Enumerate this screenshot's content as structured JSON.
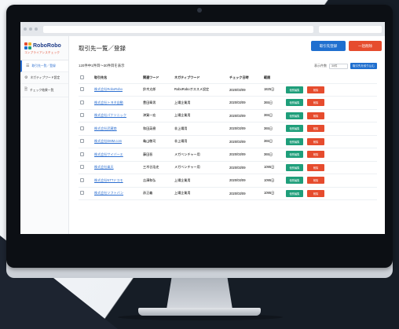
{
  "browser": {
    "url": "",
    "search_placeholder": ""
  },
  "sidebar": {
    "logo_name": "RoboRobo",
    "logo_sub": "コンプライアンスチェック",
    "items": [
      {
        "label": "取引先一覧／登録",
        "icon": "list-icon"
      },
      {
        "label": "ネガティブワード設定",
        "icon": "gear-icon"
      },
      {
        "label": "チェック結果一覧",
        "icon": "document-icon"
      }
    ]
  },
  "main": {
    "title": "取引先一覧／登録",
    "register_button": "取引先登録",
    "bulk_delete_button": "一括削除",
    "range_text": "120件中1件目〜30件目を表示",
    "per_page_label": "表示件数",
    "per_page_value": "30件",
    "per_page_button": "取引先を絞り込む",
    "columns": [
      "取引先名",
      "関連ワード",
      "ネガティブワード",
      "チェック日時",
      "範囲"
    ],
    "edit_label": "個別編集",
    "delete_label": "削除",
    "rows": [
      {
        "name": "株式会社RoboRobo",
        "related": "鈴木太郎",
        "negative": "RoboRoboオススメ設定",
        "date": "2020/03/09",
        "range": "1825日"
      },
      {
        "name": "株式会社トヨタ自動",
        "related": "豊田章男",
        "negative": "上場企業用",
        "date": "2020/03/09",
        "range": "365日"
      },
      {
        "name": "株式会社パナソニック",
        "related": "津賀一宏",
        "negative": "上場企業用",
        "date": "2020/03/09",
        "range": "365日"
      },
      {
        "name": "株式会社武蔵商",
        "related": "和田英樹",
        "negative": "非上場用",
        "date": "2020/03/09",
        "range": "365日"
      },
      {
        "name": "株式会社DMM.com",
        "related": "亀山敬司",
        "negative": "非上場用",
        "date": "2020/03/09",
        "range": "365日"
      },
      {
        "name": "株式会社サイバーエ",
        "related": "藤田晋",
        "negative": "メガベンチャー用",
        "date": "2020/03/09",
        "range": "365日"
      },
      {
        "name": "株式会社楽天",
        "related": "三木谷浩史",
        "negative": "メガベンチャー用",
        "date": "2020/03/09",
        "range": "1095日"
      },
      {
        "name": "株式会社NTTドコモ",
        "related": "吉澤和弘",
        "negative": "上場企業用",
        "date": "2020/03/09",
        "range": "1095日"
      },
      {
        "name": "株式会社ソフトバン",
        "related": "孫正義",
        "negative": "上場企業用",
        "date": "2020/03/09",
        "range": "1095日"
      }
    ]
  },
  "colors": {
    "primary": "#1f6fcf",
    "danger": "#e64c2e",
    "edit": "#1e9e7a",
    "logo": "#1f3c88"
  }
}
